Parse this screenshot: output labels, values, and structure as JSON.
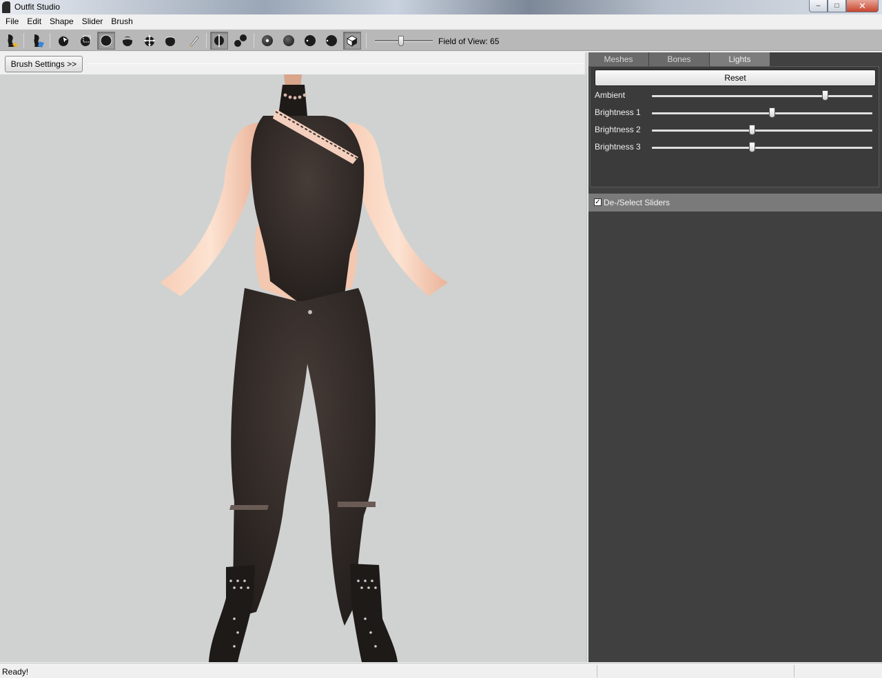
{
  "window": {
    "title": "Outfit Studio",
    "min_symbol": "–",
    "max_symbol": "□",
    "close_symbol": "✕"
  },
  "menu": [
    "File",
    "Edit",
    "Shape",
    "Slider",
    "Brush"
  ],
  "toolbar": {
    "icons": [
      "new-project-icon",
      "load-outfit-icon",
      "select-brush-icon",
      "mask-brush-icon",
      "inflate-brush-icon",
      "deflate-brush-icon",
      "move-brush-icon",
      "smooth-brush-icon",
      "weight-brush-icon",
      "mirror-x-icon",
      "connected-only-icon",
      "brush-size-small-icon",
      "brush-size-medium-icon",
      "brush-size-large-icon",
      "brush-size-xlarge-icon",
      "cube-view-icon"
    ],
    "fov_label": "Field of View: 65",
    "fov_value": 65
  },
  "brush_settings_label": "Brush Settings >>",
  "tabs": [
    "Meshes",
    "Bones",
    "Lights"
  ],
  "active_tab": "Lights",
  "lights": {
    "reset_label": "Reset",
    "sliders": [
      {
        "label": "Ambient",
        "fraction": 0.785
      },
      {
        "label": "Brightness 1",
        "fraction": 0.545
      },
      {
        "label": "Brightness 2",
        "fraction": 0.452
      },
      {
        "label": "Brightness 3",
        "fraction": 0.452
      }
    ]
  },
  "sliders_panel": {
    "checkbox_label": "De-/Select Sliders",
    "checked": true,
    "check_mark": "✓"
  },
  "status": {
    "text": "Ready!"
  },
  "colors": {
    "viewport_bg": "#cfd2d1",
    "panel_bg": "#414141",
    "outfit": "#2b2421",
    "skin": "#f2c2a8"
  }
}
